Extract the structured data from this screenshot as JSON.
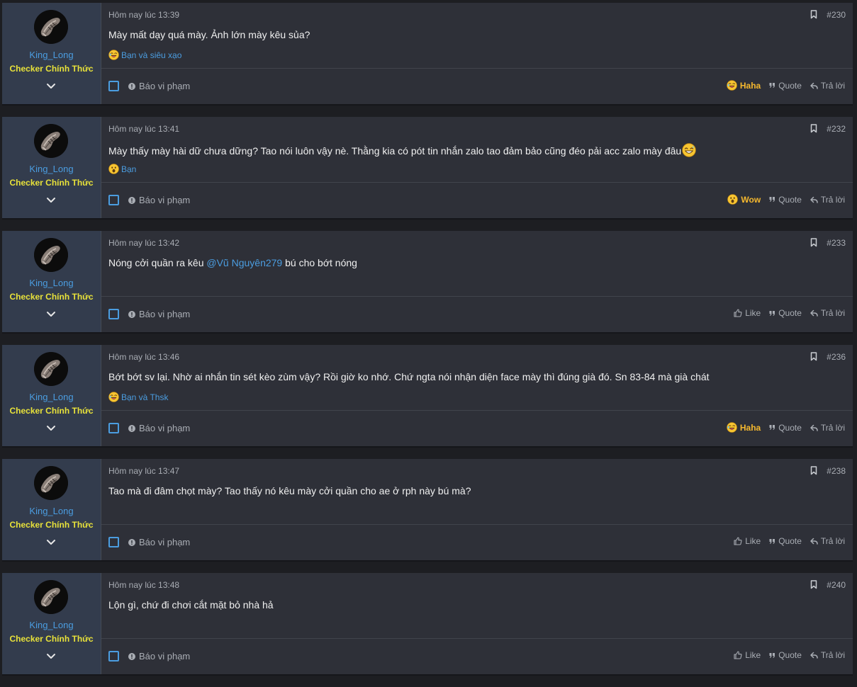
{
  "colors": {
    "page_background": "#1d1e22",
    "post_background": "#2e3038",
    "user_cell_background": "#333c4d",
    "username": "#4b9de0",
    "user_title": "#e8e23a",
    "reaction_active": "#f5b82e",
    "muted_text": "#a9adb4",
    "link": "#4b9de0"
  },
  "posts": [
    {
      "username": "King_Long",
      "user_title": "Checker Chính Thức",
      "date": "Hôm nay lúc 13:39",
      "number": "#230",
      "message": "Mày mất dạy quá mày. Ảnh lớn mày kêu sủa?",
      "reaction_summary": {
        "icon": "laughing-emoji-icon",
        "text": "Bạn và siêu xạo"
      },
      "report_label": "Báo vi phạm",
      "react_button": {
        "label": "Haha",
        "icon": "laughing-emoji-icon",
        "active": true
      },
      "quote_label": "Quote",
      "reply_label": "Trả lời"
    },
    {
      "username": "King_Long",
      "user_title": "Checker Chính Thức",
      "date": "Hôm nay lúc 13:41",
      "number": "#232",
      "message": "Mày thấy mày hài dữ chưa dững? Tao nói luôn vậy nè. Thằng kia có pót tin nhắn zalo tao đảm bảo cũng đéo pải acc zalo mày đâu",
      "message_emoji": "grinning-sweat-emoji-icon",
      "reaction_summary": {
        "icon": "wow-emoji-icon",
        "text": "Bạn"
      },
      "report_label": "Báo vi phạm",
      "react_button": {
        "label": "Wow",
        "icon": "wow-emoji-icon",
        "active": true
      },
      "quote_label": "Quote",
      "reply_label": "Trả lời"
    },
    {
      "username": "King_Long",
      "user_title": "Checker Chính Thức",
      "date": "Hôm nay lúc 13:42",
      "number": "#233",
      "message_before_mention": "Nóng cởi quần ra kêu ",
      "mention": "@Vũ Nguyên279",
      "message_after_mention": " bú cho bớt nóng",
      "report_label": "Báo vi phạm",
      "react_button": {
        "label": "Like",
        "icon": "thumbs-up-icon",
        "active": false
      },
      "quote_label": "Quote",
      "reply_label": "Trả lời"
    },
    {
      "username": "King_Long",
      "user_title": "Checker Chính Thức",
      "date": "Hôm nay lúc 13:46",
      "number": "#236",
      "message": "Bớt bớt sv lại. Nhờ ai nhắn tin sét kèo zùm vậy? Rồi giờ ko nhớ. Chứ ngta nói nhận diện face mày thì đúng già đó. Sn 83-84 mà già chát",
      "reaction_summary": {
        "icon": "laughing-emoji-icon",
        "text": "Bạn và Thsk"
      },
      "report_label": "Báo vi phạm",
      "react_button": {
        "label": "Haha",
        "icon": "laughing-emoji-icon",
        "active": true
      },
      "quote_label": "Quote",
      "reply_label": "Trả lời"
    },
    {
      "username": "King_Long",
      "user_title": "Checker Chính Thức",
      "date": "Hôm nay lúc 13:47",
      "number": "#238",
      "message": "Tao mà đi đâm chọt mày? Tao thấy nó kêu mày cởi quần cho ae ở rph này bú mà?",
      "report_label": "Báo vi phạm",
      "react_button": {
        "label": "Like",
        "icon": "thumbs-up-icon",
        "active": false
      },
      "quote_label": "Quote",
      "reply_label": "Trả lời"
    },
    {
      "username": "King_Long",
      "user_title": "Checker Chính Thức",
      "date": "Hôm nay lúc 13:48",
      "number": "#240",
      "message": "Lộn gì, chứ đi chơi cắt mặt bỏ nhà hả",
      "report_label": "Báo vi phạm",
      "react_button": {
        "label": "Like",
        "icon": "thumbs-up-icon",
        "active": false
      },
      "quote_label": "Quote",
      "reply_label": "Trả lời"
    }
  ]
}
